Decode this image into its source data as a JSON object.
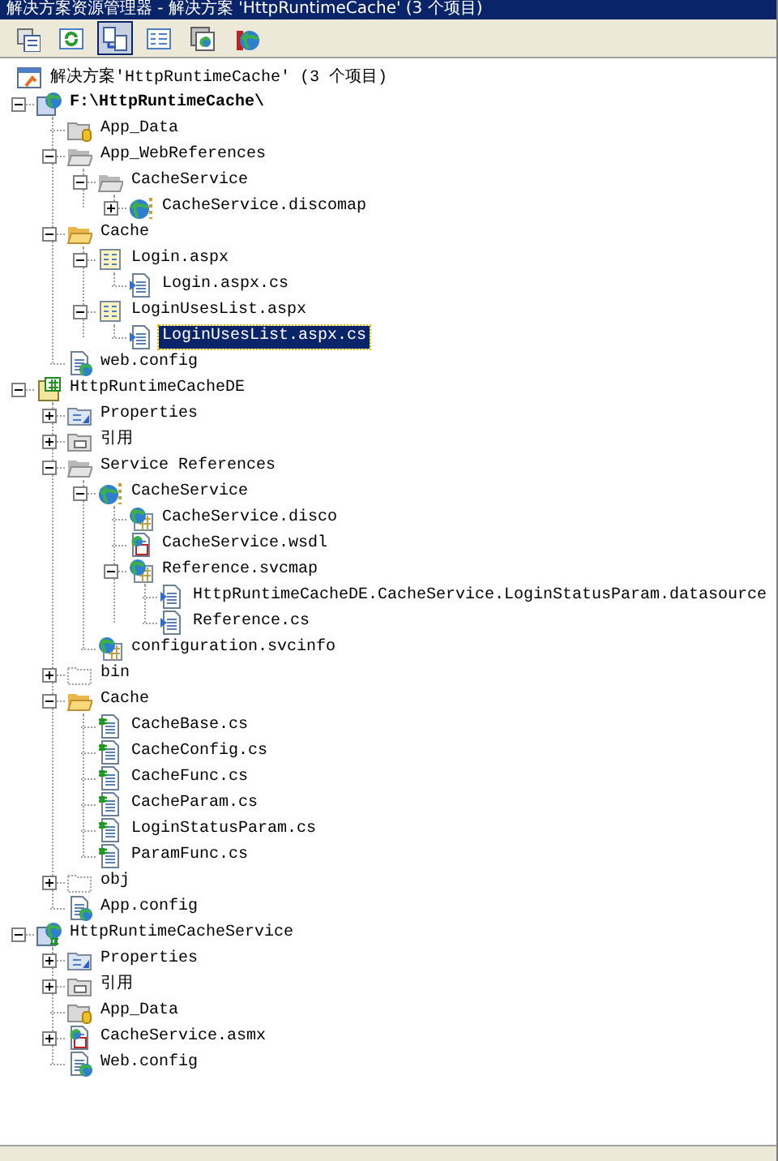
{
  "window": {
    "title": "解决方案资源管理器 - 解决方案 'HttpRuntimeCache' (3 个项目)"
  },
  "toolbar": [
    {
      "kind": "properties",
      "selected": false
    },
    {
      "kind": "refresh",
      "selected": false
    },
    {
      "kind": "show-all",
      "selected": true
    },
    {
      "kind": "view-code",
      "selected": false
    },
    {
      "kind": "designer",
      "selected": false
    },
    {
      "kind": "web-config",
      "selected": false
    }
  ],
  "tree": [
    {
      "label": "解决方案'HttpRuntimeCache' (3 个项目)",
      "kind": "solution",
      "children": [
        {
          "label": "F:\\HttpRuntimeCache\\",
          "kind": "web-project",
          "bold": true,
          "expanded": true,
          "children": [
            {
              "label": "App_Data",
              "kind": "data-folder"
            },
            {
              "label": "App_WebReferences",
              "kind": "folder-gray",
              "expanded": true,
              "children": [
                {
                  "label": "CacheService",
                  "kind": "folder-gray",
                  "expanded": true,
                  "children": [
                    {
                      "label": "CacheService.discomap",
                      "kind": "web-service",
                      "expanded": false
                    }
                  ]
                }
              ]
            },
            {
              "label": "Cache",
              "kind": "folder-open",
              "expanded": true,
              "children": [
                {
                  "label": "Login.aspx",
                  "kind": "aspx",
                  "expanded": true,
                  "children": [
                    {
                      "label": "Login.aspx.cs",
                      "kind": "code"
                    }
                  ]
                },
                {
                  "label": "LoginUsesList.aspx",
                  "kind": "aspx",
                  "expanded": true,
                  "children": [
                    {
                      "label": "LoginUsesList.aspx.cs",
                      "kind": "code",
                      "selected": true
                    }
                  ]
                }
              ]
            },
            {
              "label": "web.config",
              "kind": "config"
            }
          ]
        },
        {
          "label": "HttpRuntimeCacheDE",
          "kind": "cs-project",
          "expanded": true,
          "children": [
            {
              "label": "Properties",
              "kind": "properties",
              "expanded": false
            },
            {
              "label": "引用",
              "kind": "references",
              "expanded": false
            },
            {
              "label": "Service References",
              "kind": "folder-gray",
              "expanded": true,
              "children": [
                {
                  "label": "CacheService",
                  "kind": "web-service",
                  "expanded": true,
                  "children": [
                    {
                      "label": "CacheService.disco",
                      "kind": "web-doc"
                    },
                    {
                      "label": "CacheService.wsdl",
                      "kind": "wsdl"
                    },
                    {
                      "label": "Reference.svcmap",
                      "kind": "web-doc",
                      "expanded": true,
                      "children": [
                        {
                          "label": "HttpRuntimeCacheDE.CacheService.LoginStatusParam.datasource",
                          "kind": "code"
                        },
                        {
                          "label": "Reference.cs",
                          "kind": "code"
                        }
                      ]
                    }
                  ]
                },
                {
                  "label": "configuration.svcinfo",
                  "kind": "web-doc"
                }
              ]
            },
            {
              "label": "bin",
              "kind": "folder-hidden",
              "expanded": false
            },
            {
              "label": "Cache",
              "kind": "folder-open",
              "expanded": true,
              "children": [
                {
                  "label": "CacheBase.cs",
                  "kind": "cs-file"
                },
                {
                  "label": "CacheConfig.cs",
                  "kind": "cs-file"
                },
                {
                  "label": "CacheFunc.cs",
                  "kind": "cs-file"
                },
                {
                  "label": "CacheParam.cs",
                  "kind": "cs-file"
                },
                {
                  "label": "LoginStatusParam.cs",
                  "kind": "cs-file"
                },
                {
                  "label": "ParamFunc.cs",
                  "kind": "cs-file"
                }
              ]
            },
            {
              "label": "obj",
              "kind": "folder-hidden",
              "expanded": false
            },
            {
              "label": "App.config",
              "kind": "config"
            }
          ]
        },
        {
          "label": "HttpRuntimeCacheService",
          "kind": "cs-web-project",
          "expanded": true,
          "children": [
            {
              "label": "Properties",
              "kind": "properties",
              "expanded": false
            },
            {
              "label": "引用",
              "kind": "references",
              "expanded": false
            },
            {
              "label": "App_Data",
              "kind": "data-folder"
            },
            {
              "label": "CacheService.asmx",
              "kind": "wsdl",
              "expanded": false
            },
            {
              "label": "Web.config",
              "kind": "config"
            }
          ]
        }
      ]
    }
  ]
}
